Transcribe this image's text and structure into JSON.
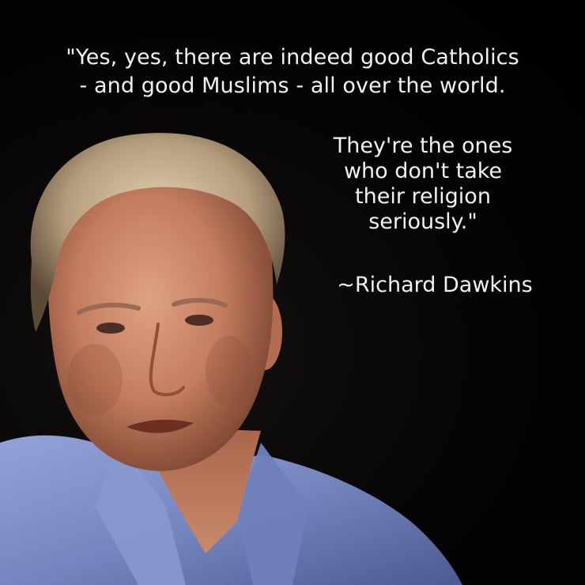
{
  "quote": {
    "line1": "\"Yes, yes, there are indeed good Catholics",
    "line2": "- and good Muslims - all over the world.",
    "line3": "They're the ones",
    "line4": "who don't take",
    "line5": "their religion",
    "line6": "seriously.\""
  },
  "attribution": "~Richard Dawkins",
  "colors": {
    "background": "#000000",
    "text": "#f2f2f2",
    "shirt": "#7f8fc6",
    "skin": "#c8866a",
    "hair": "#cdb79a"
  }
}
